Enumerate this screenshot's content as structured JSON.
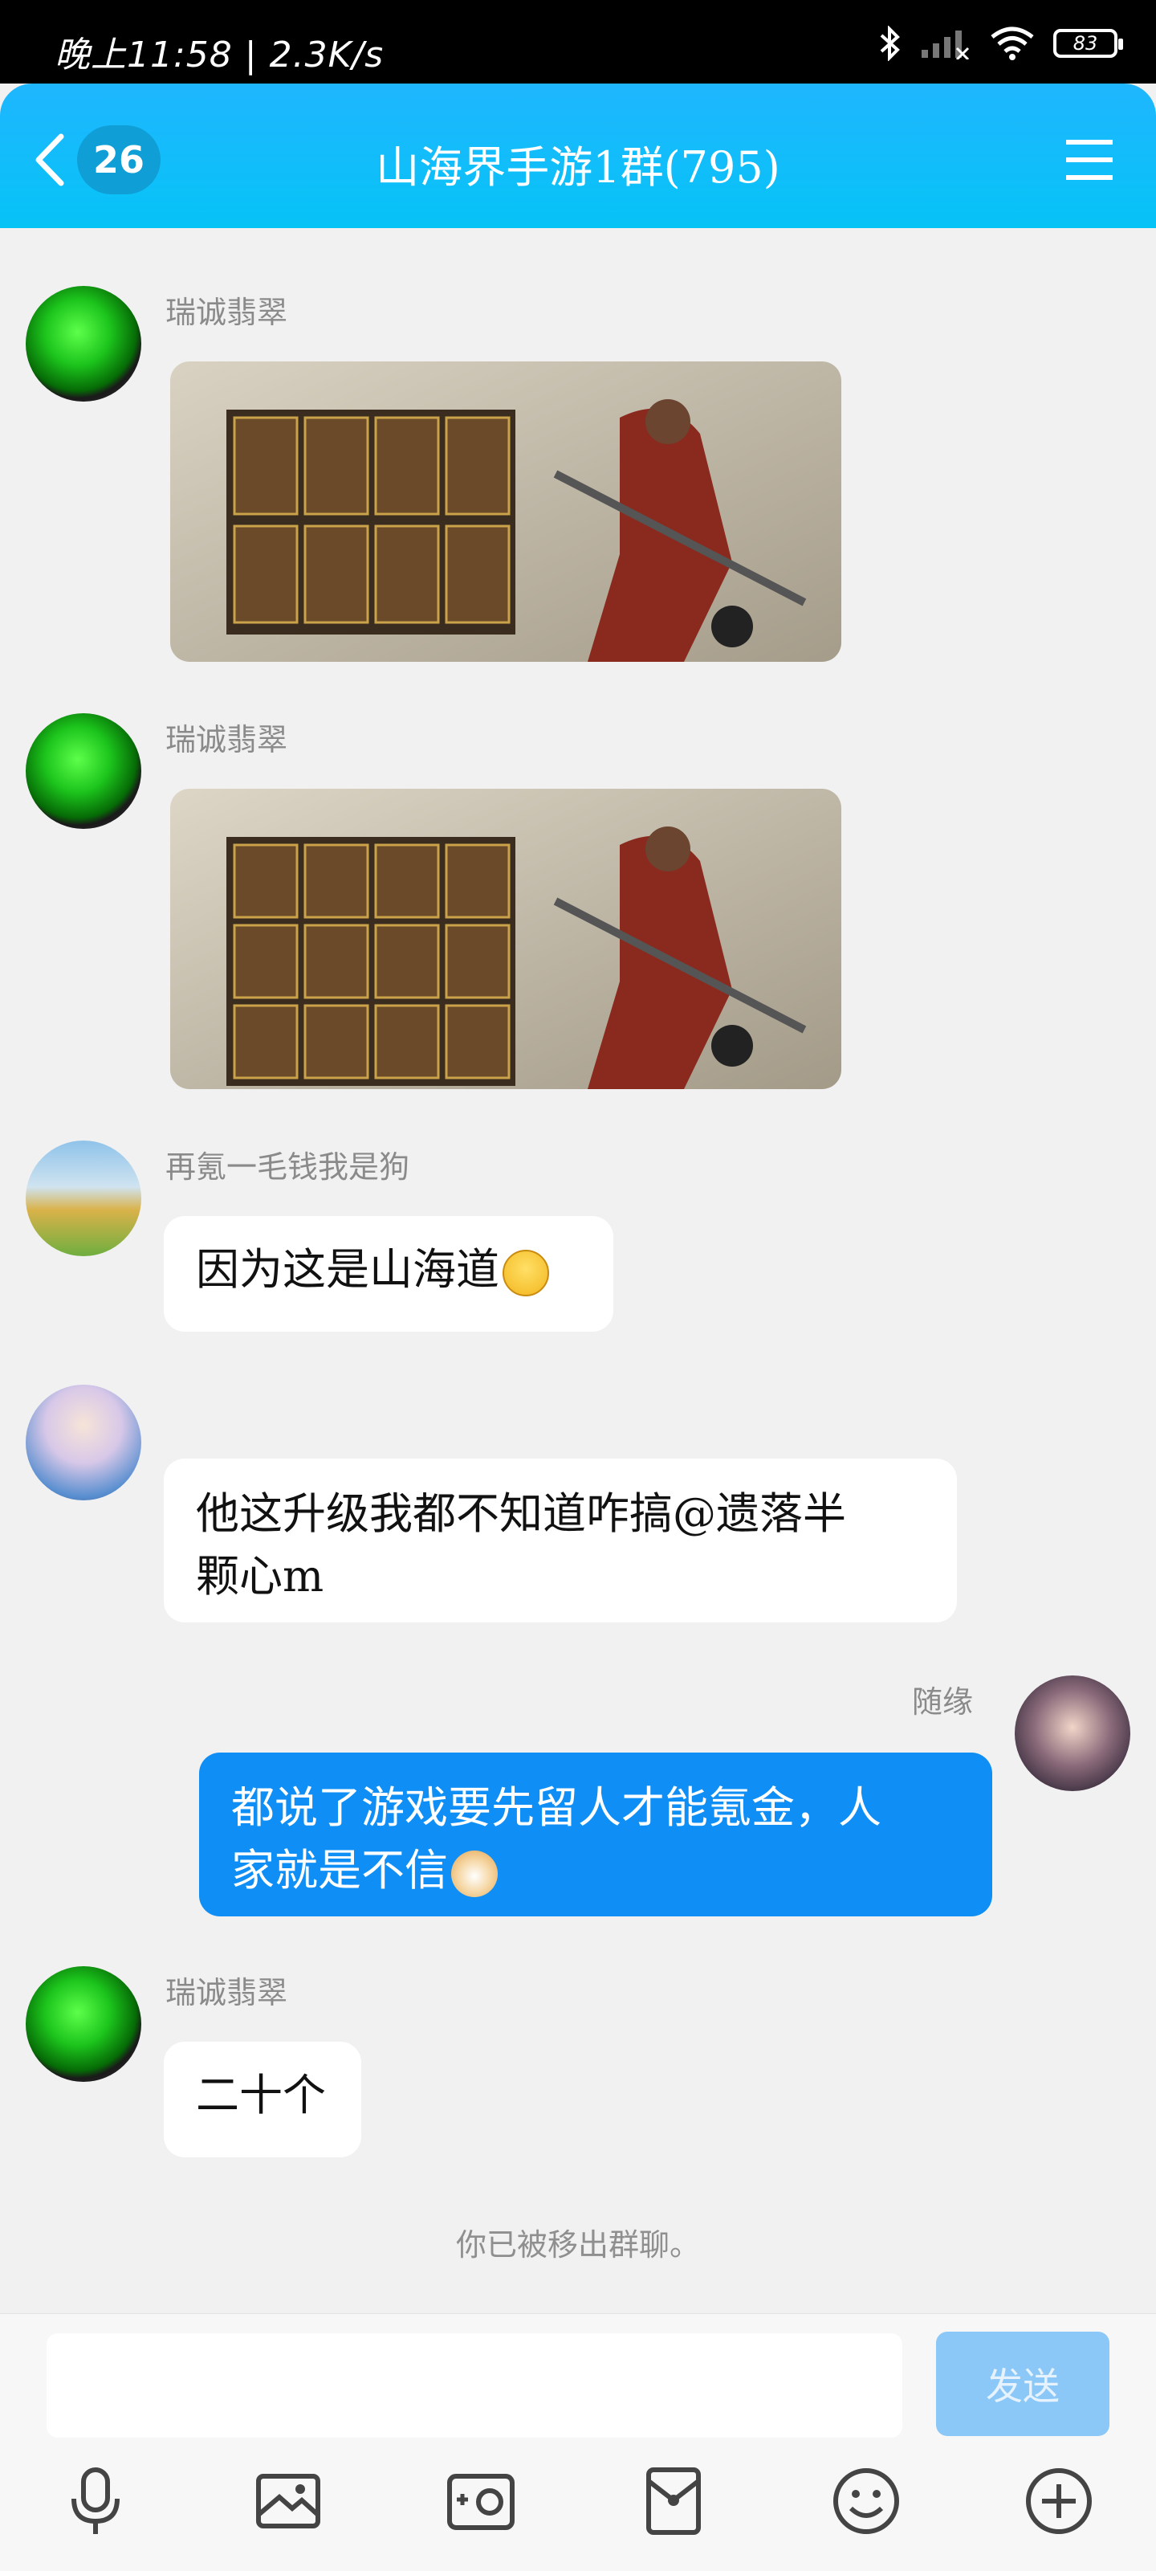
{
  "status_bar": {
    "time": "晚上11:58 | 2.3K/s",
    "battery": "83"
  },
  "header": {
    "unread_count": "26",
    "title": "山海界手游1群(795)"
  },
  "messages": [
    {
      "sender": "瑞诚翡翠",
      "kind": "image"
    },
    {
      "sender": "瑞诚翡翠",
      "kind": "image"
    },
    {
      "sender": "再氪一毛钱我是狗",
      "text": "因为这是山海道"
    },
    {
      "sender": "",
      "text_line1": "他这升级我都不知道咋搞@遗落半",
      "text_line2": "颗心m"
    },
    {
      "sender": "随缘",
      "text_line1": "都说了游戏要先留人才能氪金，人",
      "text_line2": "家就是不信"
    },
    {
      "sender": "瑞诚翡翠",
      "text": "二十个"
    }
  ],
  "system_message": "你已被移出群聊。",
  "input": {
    "value": "",
    "send_label": "发送"
  },
  "colors": {
    "header": "#1fb6ff",
    "self_bubble": "#0f8ff5",
    "send_disabled": "#8cc8f7"
  },
  "toolbar_icons": [
    "microphone-icon",
    "photo-icon",
    "camera-icon",
    "red-packet-icon",
    "emoji-icon",
    "plus-icon"
  ]
}
